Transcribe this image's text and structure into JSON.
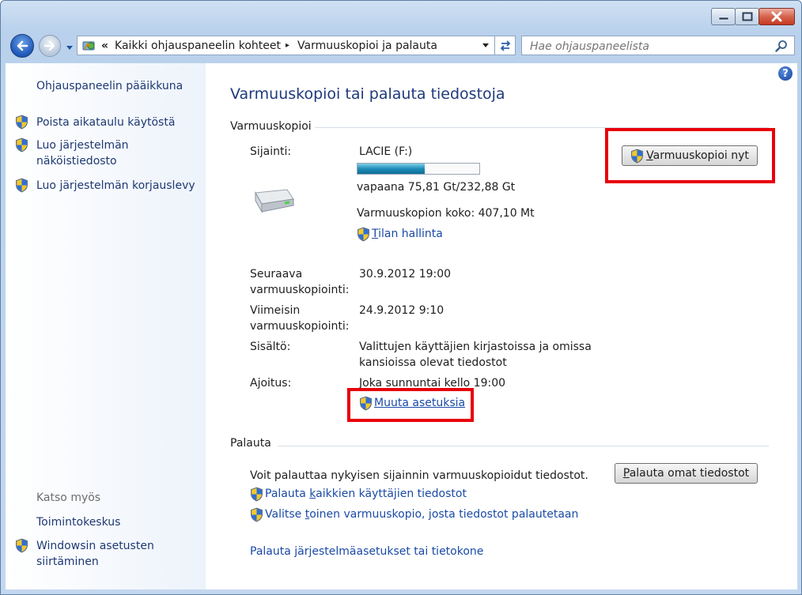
{
  "window": {
    "caption_buttons": [
      "minimize",
      "maximize",
      "close"
    ]
  },
  "address_bar": {
    "overflow_glyph": "«",
    "breadcrumb": [
      "Kaikki ohjauspaneelin kohteet",
      "Varmuuskopioi ja palauta"
    ],
    "separator_glyph": "▸"
  },
  "search": {
    "placeholder": "Hae ohjauspaneelista"
  },
  "sidebar": {
    "home": "Ohjauspaneelin pääikkuna",
    "tasks": [
      {
        "label": "Poista aikataulu käytöstä",
        "icon": "uac-shield-icon"
      },
      {
        "label_line1": "Luo järjestelmän",
        "label_line2": "näköistiedosto",
        "icon": "uac-shield-icon"
      },
      {
        "label": "Luo järjestelmän korjauslevy",
        "icon": "uac-shield-icon"
      }
    ],
    "see_also": {
      "heading": "Katso myös",
      "items": [
        {
          "label": "Toimintokeskus"
        },
        {
          "label_line1": "Windowsin asetusten",
          "label_line2": "siirtäminen",
          "icon": "uac-shield-icon"
        }
      ]
    }
  },
  "main": {
    "help_glyph": "?",
    "title": "Varmuuskopioi tai palauta tiedostoja",
    "backup": {
      "heading": "Varmuuskopioi",
      "location_label": "Sijainti:",
      "location_value": "LACIE (F:)",
      "usage_fraction": 0.55,
      "free_space": "vapaana 75,81 Gt/232,88 Gt",
      "backup_size": "Varmuuskopion koko: 407,10 Mt",
      "manage_space_link_u": "T",
      "manage_space_link_rest": "ilan hallinta",
      "backup_now_u": "V",
      "backup_now_rest": "armuuskopioi nyt",
      "next_label_line1": "Seuraava",
      "next_label_line2": "varmuuskopiointi:",
      "next_value": "30.9.2012 19:00",
      "last_label_line1": "Viimeisin",
      "last_label_line2": "varmuuskopiointi:",
      "last_value": "24.9.2012 9:10",
      "contents_label": "Sisältö:",
      "contents_value_line1": "Valittujen käyttäjien kirjastoissa ja omissa",
      "contents_value_line2": "kansioissa olevat tiedostot",
      "schedule_label": "Ajoitus:",
      "schedule_value": "Joka sunnuntai kello 19:00",
      "change_settings_u": "M",
      "change_settings_rest": "uuta asetuksia"
    },
    "restore": {
      "heading": "Palauta",
      "description": "Voit palauttaa nykyisen sijainnin varmuuskopioidut tiedostot.",
      "restore_my_files_u": "P",
      "restore_my_files_rest": "alauta omat tiedostot",
      "all_users_pre": "Palauta ",
      "all_users_u": "k",
      "all_users_post": "aikkien käyttäjien tiedostot",
      "select_other_pre": "Valitse ",
      "select_other_u": "t",
      "select_other_post": "oinen varmuuskopio, josta tiedostot palautetaan",
      "system_restore": "Palauta järjestelmäasetukset tai tietokone"
    },
    "highlight_color": "#e8000b"
  }
}
